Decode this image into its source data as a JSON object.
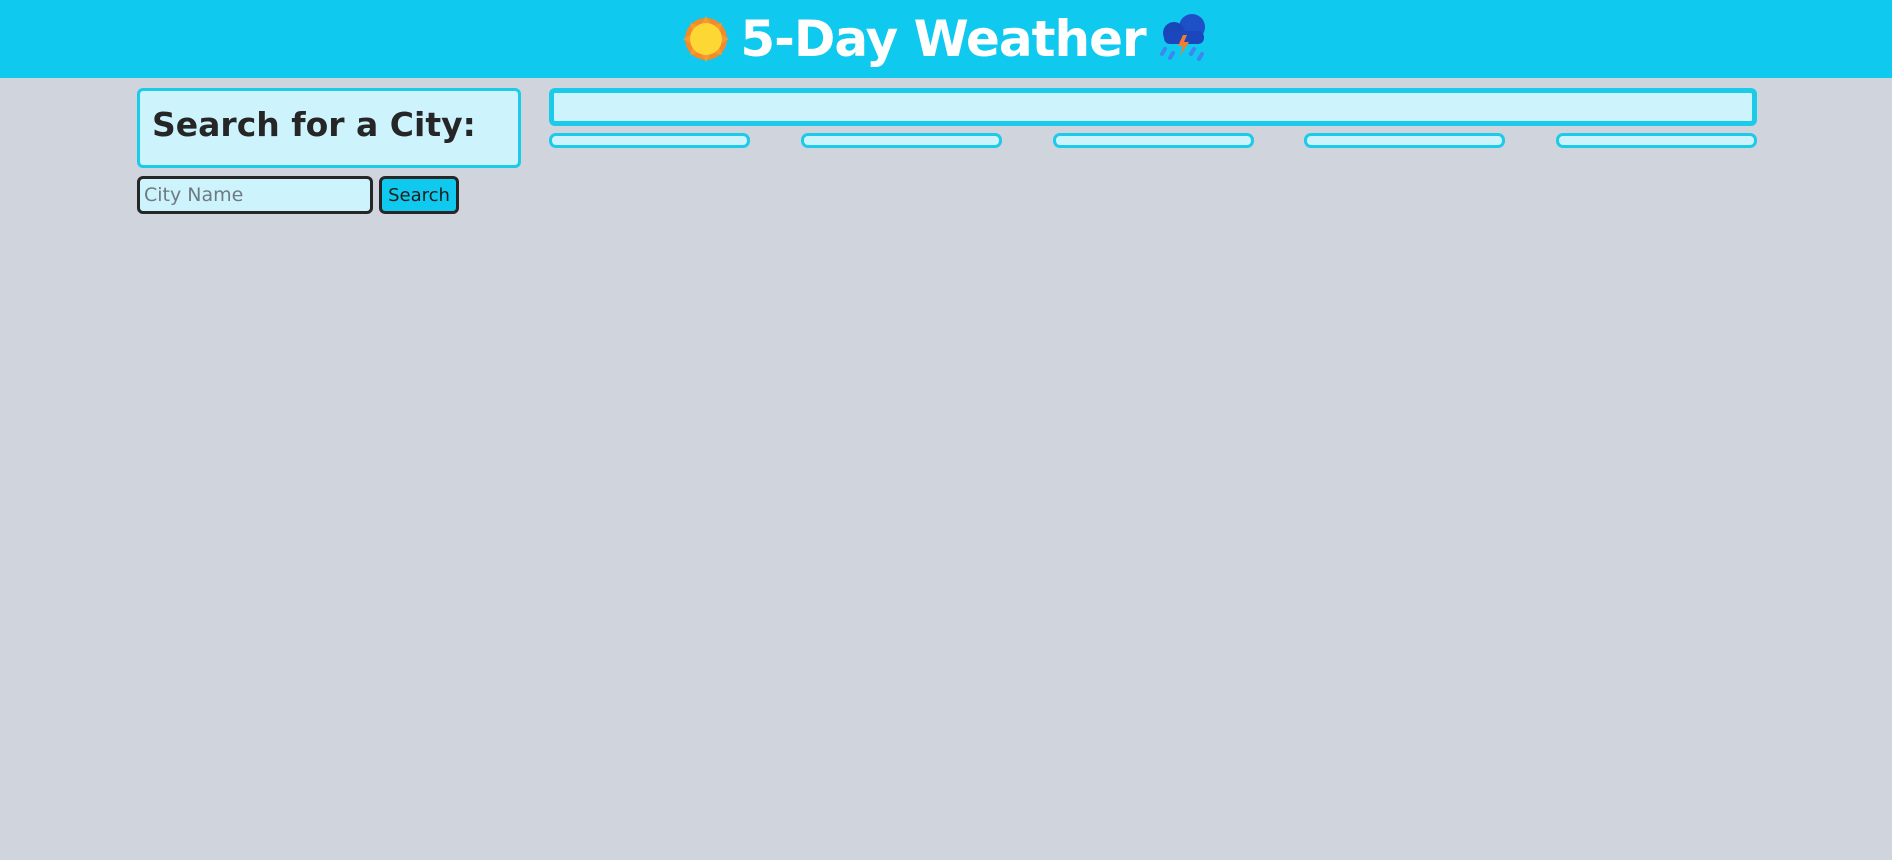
{
  "header": {
    "title": "5-Day Weather",
    "left_icon": "sun-icon",
    "right_icon": "thunderstorm-icon"
  },
  "search": {
    "heading": "Search for a City:",
    "placeholder": "City Name",
    "value": "",
    "button_label": "Search"
  },
  "current_weather": {
    "content": ""
  },
  "forecast": {
    "cards": [
      {
        "content": ""
      },
      {
        "content": ""
      },
      {
        "content": ""
      },
      {
        "content": ""
      },
      {
        "content": ""
      }
    ]
  },
  "colors": {
    "header_bg": "#0fc9ee",
    "page_bg": "#d0d4dc",
    "card_bg": "#cdf4fd",
    "card_border": "#1ccbe9",
    "text": "#262626"
  }
}
